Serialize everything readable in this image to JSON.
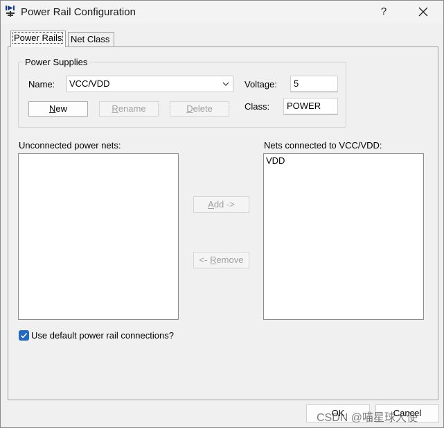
{
  "window": {
    "title": "Power Rail Configuration",
    "help_label": "?",
    "close_icon": "close-icon",
    "app_icon": "power-rail-icon"
  },
  "tabs": [
    {
      "label": "Power Rails",
      "selected": true
    },
    {
      "label": "Net Class",
      "selected": false
    }
  ],
  "power_supplies": {
    "group_label": "Power Supplies",
    "name_label": "Name:",
    "name_value": "VCC/VDD",
    "voltage_label": "Voltage:",
    "voltage_value": "5",
    "class_label": "Class:",
    "class_value": "POWER",
    "new_prefix": "",
    "new_mnemonic": "N",
    "new_rest": "ew",
    "rename_prefix": "",
    "rename_mnemonic": "R",
    "rename_rest": "ename",
    "delete_prefix": "",
    "delete_mnemonic": "D",
    "delete_rest": "elete"
  },
  "nets": {
    "unconnected_label": "Unconnected power nets:",
    "unconnected_items": [],
    "connected_label": "Nets connected to VCC/VDD:",
    "connected_items": [
      "VDD"
    ],
    "add_prefix": "",
    "add_mnemonic": "A",
    "add_rest": "dd ->",
    "remove_prefix": "<- ",
    "remove_mnemonic": "R",
    "remove_rest": "emove"
  },
  "options": {
    "default_connections_label": "Use default power rail connections?",
    "default_connections_checked": true
  },
  "footer": {
    "ok_label": "OK",
    "cancel_label": "Cancel",
    "watermark": "CSDN @喵星球大使"
  },
  "colors": {
    "accent": "#2169c2",
    "disabled_text": "#a0a0a0"
  }
}
